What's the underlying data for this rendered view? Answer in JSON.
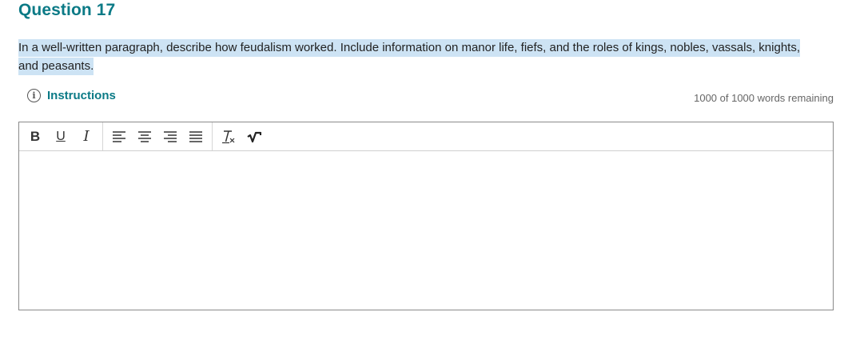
{
  "question": {
    "title": "Question 17",
    "prompt": "In a well-written paragraph, describe how feudalism worked. Include information on manor life, fiefs, and the roles of kings, nobles, vassals, knights, and peasants."
  },
  "instructions": {
    "label": "Instructions",
    "icon": "info-icon"
  },
  "word_count": {
    "text": "1000 of 1000 words remaining"
  },
  "toolbar": {
    "buttons": [
      {
        "name": "bold-button",
        "icon": "bold-icon",
        "glyph": "B"
      },
      {
        "name": "underline-button",
        "icon": "underline-icon",
        "glyph": "U"
      },
      {
        "name": "italic-button",
        "icon": "italic-icon",
        "glyph": "I"
      },
      {
        "name": "align-left-button",
        "icon": "align-left-icon"
      },
      {
        "name": "align-center-button",
        "icon": "align-center-icon"
      },
      {
        "name": "align-right-button",
        "icon": "align-right-icon"
      },
      {
        "name": "justify-button",
        "icon": "justify-icon"
      },
      {
        "name": "clear-formatting-button",
        "icon": "clear-formatting-icon"
      },
      {
        "name": "equation-button",
        "icon": "square-root-icon"
      }
    ]
  },
  "editor": {
    "value": ""
  },
  "colors": {
    "accent": "#0b7a86",
    "highlight": "#cde3f4"
  }
}
